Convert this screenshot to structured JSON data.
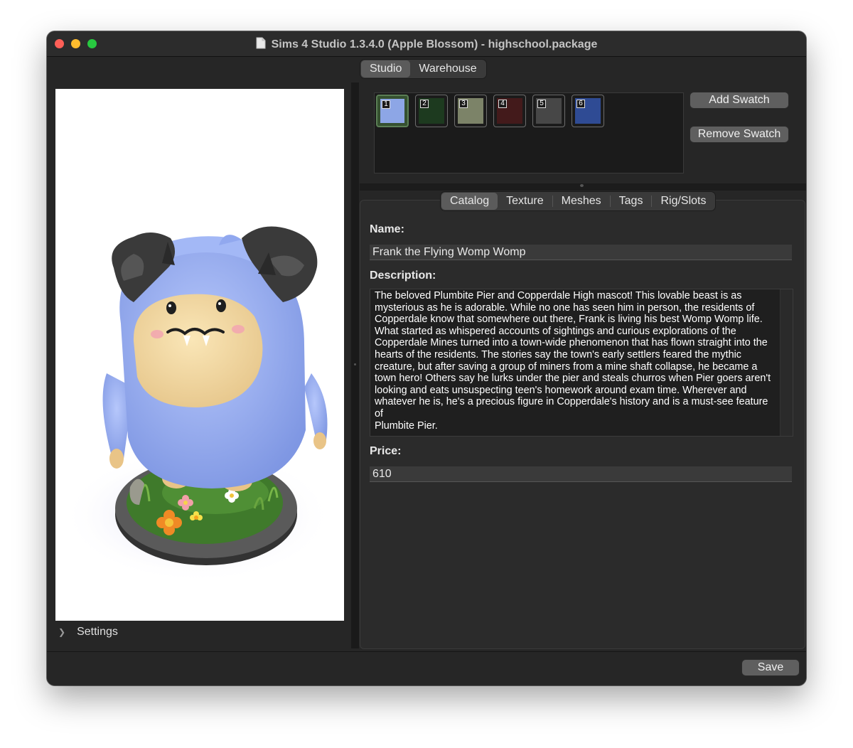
{
  "window": {
    "title": "Sims 4 Studio 1.3.4.0 (Apple Blossom)  - highschool.package",
    "icon": "document-icon"
  },
  "top_tabs": [
    {
      "label": "Studio",
      "active": true
    },
    {
      "label": "Warehouse",
      "active": false
    }
  ],
  "swatches": [
    {
      "number": "1",
      "color": "#8da6e6",
      "selected": true
    },
    {
      "number": "2",
      "color": "#1d3a1f",
      "selected": false
    },
    {
      "number": "3",
      "color": "#7c8368",
      "selected": false
    },
    {
      "number": "4",
      "color": "#431a1b",
      "selected": false
    },
    {
      "number": "5",
      "color": "#474747",
      "selected": false
    },
    {
      "number": "6",
      "color": "#2f4b94",
      "selected": false
    }
  ],
  "swatch_buttons": {
    "add": "Add Swatch",
    "remove": "Remove Swatch"
  },
  "detail_tabs": [
    {
      "label": "Catalog",
      "active": true
    },
    {
      "label": "Texture",
      "active": false
    },
    {
      "label": "Meshes",
      "active": false
    },
    {
      "label": "Tags",
      "active": false
    },
    {
      "label": "Rig/Slots",
      "active": false
    }
  ],
  "catalog": {
    "name_label": "Name:",
    "name_value": "Frank the Flying Womp Womp",
    "description_label": "Description:",
    "description_value": "The beloved Plumbite Pier and Copperdale High mascot! This lovable beast is as\nmysterious as he is adorable. While no one has seen him in person, the residents of\nCopperdale know that somewhere out there, Frank is living his best Womp Womp life.\nWhat started as whispered accounts of sightings and curious explorations of the\nCopperdale Mines turned into a town-wide phenomenon that has flown straight into the\nhearts of the residents. The stories say the town's early settlers feared the mythic\ncreature, but after saving a group of miners from a mine shaft collapse, he became a\ntown hero! Others say he lurks under the pier and steals churros when Pier goers aren't\nlooking and eats unsuspecting teen's homework around exam time. Wherever and\nwhatever he is, he's a precious figure in Copperdale's history and is a must-see feature of\nPlumbite Pier.",
    "price_label": "Price:",
    "price_value": "610"
  },
  "settings_label": "Settings",
  "save_label": "Save"
}
